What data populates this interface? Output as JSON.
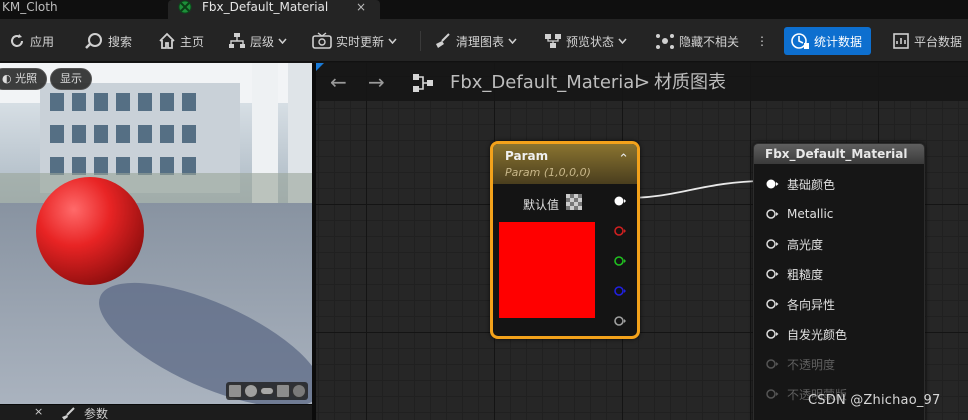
{
  "tabs": [
    {
      "label": "KM_Cloth"
    },
    {
      "label": "Fbx_Default_Material",
      "close": "×"
    }
  ],
  "toolbar": {
    "apply": "应用",
    "search": "搜索",
    "home": "主页",
    "hierarchy": "层级",
    "live_update": "实时更新",
    "clean_graph": "清理图表",
    "preview_state": "预览状态",
    "hide_unrelated": "隐藏不相关",
    "stats": "统计数据",
    "platform": "平台数据",
    "more": "⋮"
  },
  "viewport": {
    "lit_button": "光照",
    "show_button": "显示"
  },
  "graph": {
    "breadcrumb_asset": "Fbx_Default_Material",
    "breadcrumb_sep": ">",
    "breadcrumb_graph": "材质图表",
    "back_arrow": "←",
    "forward_arrow": "→"
  },
  "param_node": {
    "title": "Param",
    "subtitle": "Param (1,0,0,0)",
    "default_label": "默认值",
    "collapse": "⌃",
    "swatch_color": "#ff0000",
    "output_pins": [
      {
        "channel": "rgb",
        "color": "#ffffff"
      },
      {
        "channel": "r",
        "color": "#d02020"
      },
      {
        "channel": "g",
        "color": "#20c020"
      },
      {
        "channel": "b",
        "color": "#2020e0"
      },
      {
        "channel": "a",
        "color": "#a0a0a0"
      }
    ]
  },
  "result_node": {
    "title": "Fbx_Default_Material",
    "inputs": [
      {
        "label": "基础颜色",
        "connected": true,
        "enabled": true
      },
      {
        "label": "Metallic",
        "connected": false,
        "enabled": true
      },
      {
        "label": "高光度",
        "connected": false,
        "enabled": true
      },
      {
        "label": "粗糙度",
        "connected": false,
        "enabled": true
      },
      {
        "label": "各向异性",
        "connected": false,
        "enabled": true
      },
      {
        "label": "自发光颜色",
        "connected": false,
        "enabled": true
      },
      {
        "label": "不透明度",
        "connected": false,
        "enabled": false
      },
      {
        "label": "不透明蒙版",
        "connected": false,
        "enabled": false
      }
    ]
  },
  "bottom_panel": {
    "close": "×",
    "label": "参数"
  },
  "watermark": "CSDN @Zhichao_97"
}
